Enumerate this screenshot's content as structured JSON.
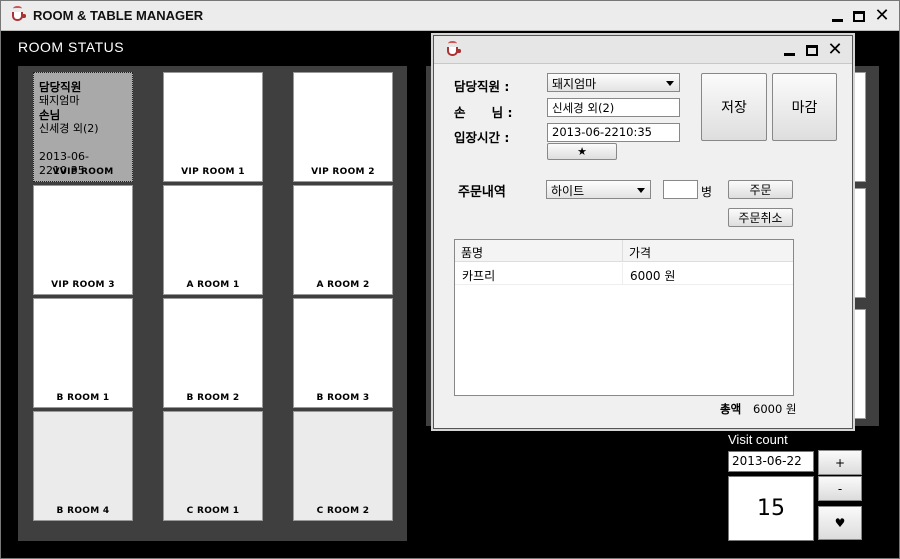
{
  "window": {
    "title": "ROOM & TABLE MANAGER",
    "icon": "coffee-cup-icon"
  },
  "room_status_label": "ROOM STATUS",
  "rooms": [
    {
      "name": "VVIP ROOM",
      "staff": "담당직원",
      "staff_name": "돼지엄마",
      "guest_label": "손님",
      "guest": "신세경 외(2)",
      "time": "2013-06-2210:35"
    },
    {
      "name": "VIP ROOM 1"
    },
    {
      "name": "VIP ROOM 2"
    },
    {
      "name": "VIP ROOM 3"
    },
    {
      "name": "A ROOM 1"
    },
    {
      "name": "A ROOM 2"
    },
    {
      "name": "B ROOM 1"
    },
    {
      "name": "B ROOM 2"
    },
    {
      "name": "B ROOM 3"
    },
    {
      "name": "B ROOM 4"
    },
    {
      "name": "C ROOM 1"
    },
    {
      "name": "C ROOM 2"
    }
  ],
  "visit": {
    "label": "Visit count",
    "date": "2013-06-22",
    "count": "15",
    "plus": "+",
    "minus": "-",
    "heart": "♥"
  },
  "dialog": {
    "staff_label": "담당직원 :",
    "staff_value": "돼지엄마",
    "guest_label": "손      님 :",
    "guest_value": "신세경 외(2)",
    "time_label": "입장시간 :",
    "time_value": "2013-06-2210:35",
    "star_btn": "★",
    "save_btn": "저장",
    "close_btn": "마감",
    "order_label": "주문내역",
    "order_item": "하이트",
    "qty_value": "",
    "qty_unit": "병",
    "order_btn": "주문",
    "cancel_btn": "주문취소",
    "table": {
      "headers": [
        "품명",
        "가격"
      ],
      "rows": [
        [
          "카프리",
          "6000 원"
        ]
      ]
    },
    "total_label": "총액",
    "total_value": "6000 원"
  }
}
